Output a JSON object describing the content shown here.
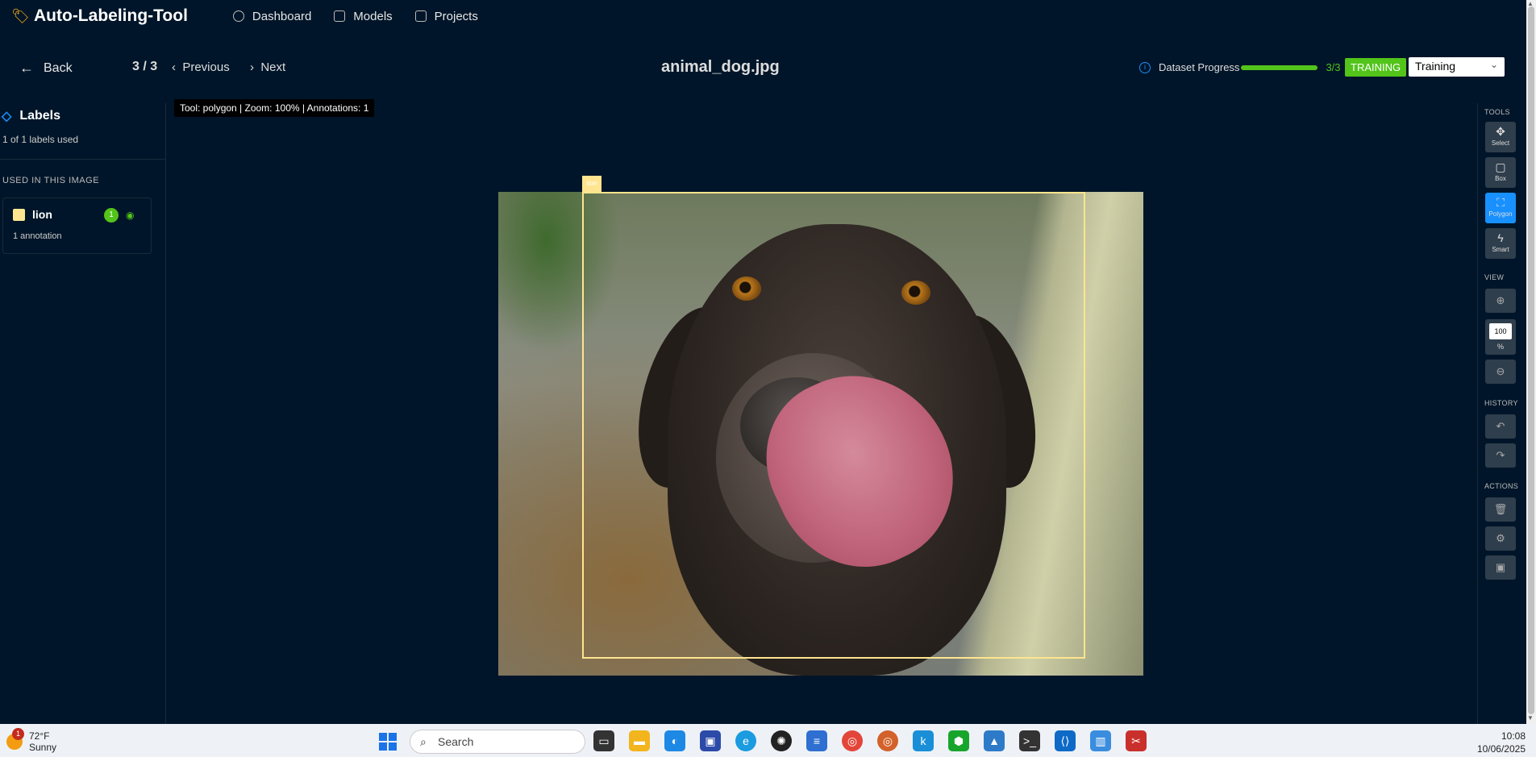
{
  "app": {
    "title": "Auto-Labeling-Tool"
  },
  "nav": [
    {
      "label": "Dashboard"
    },
    {
      "label": "Models"
    },
    {
      "label": "Projects"
    }
  ],
  "header": {
    "back": "Back",
    "counter": "3 / 3",
    "previous": "Previous",
    "next": "Next",
    "filename": "animal_dog.jpg",
    "dataset_progress_label": "Dataset Progress",
    "dataset_progress_value": "3/3",
    "dataset_progress_fraction": 1.0,
    "split_badge": "TRAINING",
    "split_select": "Training"
  },
  "sidebar": {
    "title": "Labels",
    "used_summary": "1 of 1 labels used",
    "section": "USED IN THIS IMAGE",
    "labels": [
      {
        "name": "lion",
        "count": "1",
        "annotations": "1 annotation",
        "color": "#ffe58f"
      }
    ]
  },
  "canvas": {
    "status": "Tool: polygon | Zoom: 100% | Annotations: 1",
    "annotation_label": "lion"
  },
  "toolbar": {
    "tools_title": "TOOLS",
    "tools": [
      {
        "label": "Select",
        "icon": "move-icon"
      },
      {
        "label": "Box",
        "icon": "square-icon"
      },
      {
        "label": "Polygon",
        "icon": "polygon-icon",
        "active": true
      },
      {
        "label": "Smart",
        "icon": "lightning-icon"
      }
    ],
    "view_title": "VIEW",
    "zoom_value": "100",
    "zoom_unit": "%",
    "history_title": "HISTORY",
    "actions_title": "ACTIONS"
  },
  "taskbar": {
    "temp": "72°F",
    "weather": "Sunny",
    "weather_badge": "1",
    "search_placeholder": "Search",
    "time": "10:08",
    "date": "10/06/2025"
  },
  "colors": {
    "background": "#001529",
    "accent": "#1890ff",
    "success": "#52c41a",
    "annotation": "#ffe58f"
  }
}
